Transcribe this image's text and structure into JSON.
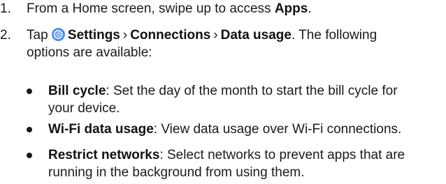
{
  "steps": [
    {
      "number": "1.",
      "text_before": "From a Home screen, swipe up to access ",
      "bold": "Apps",
      "text_after": "."
    },
    {
      "number": "2.",
      "tap": "Tap",
      "path": [
        "Settings",
        "Connections",
        "Data usage"
      ],
      "separator": "›",
      "text_after_line1": ". The following",
      "text_line2": "options are available:"
    }
  ],
  "bullets": [
    {
      "title": "Bill cycle",
      "line1": ": Set the day of the month to start the bill cycle for",
      "line2": "your device."
    },
    {
      "title": "Wi-Fi data usage",
      "line1": ": View data usage over Wi-Fi connections."
    },
    {
      "title": "Restrict networks",
      "line1": ": Select networks to prevent apps that are",
      "line2": "running in the background from using them."
    }
  ],
  "colors": {
    "settings_icon_bg": "#4a8df8",
    "settings_icon_fg": "#ffffff"
  },
  "icons": {
    "settings": "settings-gear-icon"
  }
}
